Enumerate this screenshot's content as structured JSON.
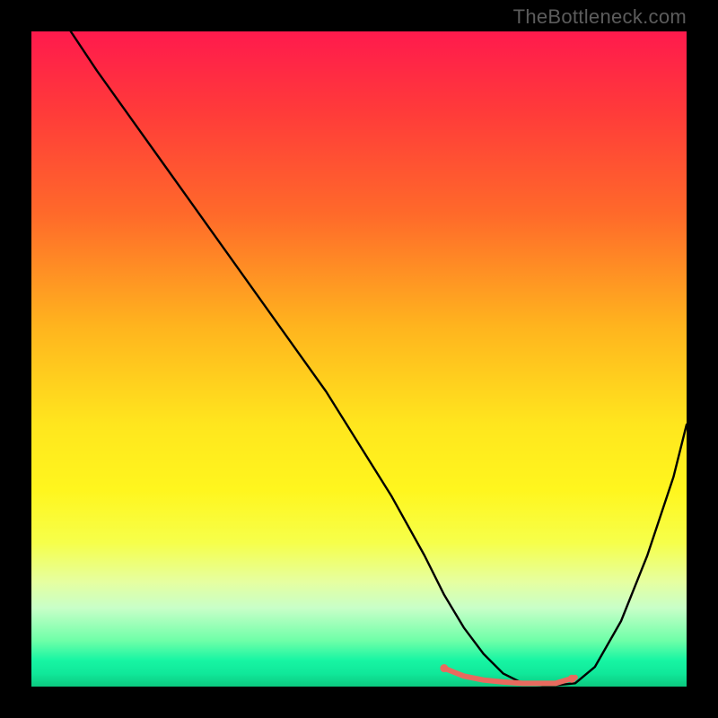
{
  "watermark": "TheBottleneck.com",
  "chart_data": {
    "type": "line",
    "title": "",
    "xlabel": "",
    "ylabel": "",
    "xlim": [
      0,
      100
    ],
    "ylim": [
      0,
      100
    ],
    "series": [
      {
        "name": "curve-black",
        "color": "#000000",
        "stroke_width": 2.4,
        "x": [
          6,
          10,
          15,
          20,
          25,
          30,
          35,
          40,
          45,
          50,
          55,
          60,
          63,
          66,
          69,
          72,
          75,
          78,
          80,
          83,
          86,
          90,
          94,
          98,
          100
        ],
        "values": [
          100,
          94,
          87,
          80,
          73,
          66,
          59,
          52,
          45,
          37,
          29,
          20,
          14,
          9,
          5,
          2,
          0.5,
          0.2,
          0.2,
          0.5,
          3,
          10,
          20,
          32,
          40
        ]
      },
      {
        "name": "highlight-segment",
        "color": "#e86a5e",
        "stroke_width": 6,
        "x": [
          63,
          66,
          69,
          72,
          75,
          78,
          80,
          83
        ],
        "values": [
          2.8,
          1.6,
          1.0,
          0.7,
          0.5,
          0.5,
          0.5,
          1.4
        ]
      }
    ],
    "highlight_dots": {
      "color": "#e86a5e",
      "radius": 4.5,
      "points": [
        {
          "x": 63,
          "y": 2.8
        },
        {
          "x": 82.5,
          "y": 1.2
        }
      ]
    },
    "background_gradient": [
      "#ff1a4d",
      "#ffe61e",
      "#10e89a"
    ]
  }
}
